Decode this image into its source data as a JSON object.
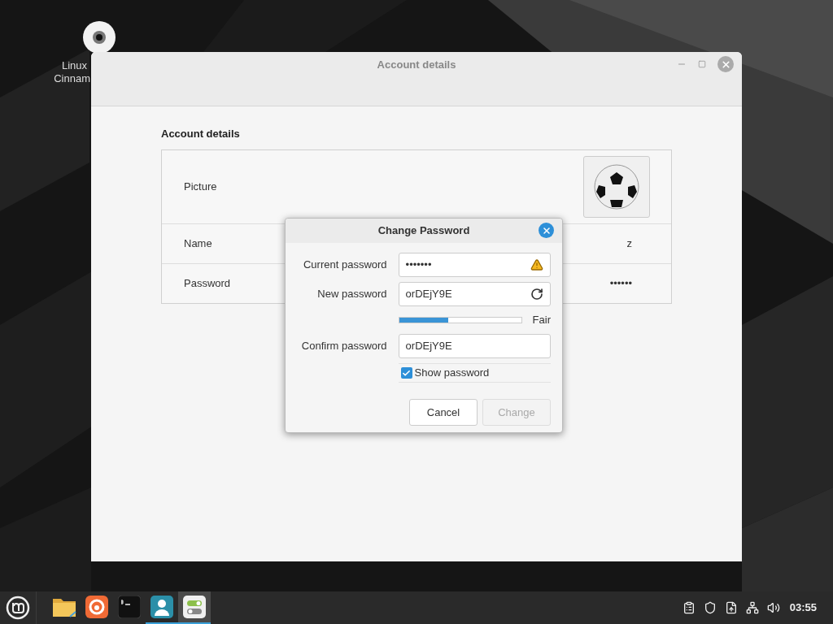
{
  "desktop": {
    "icons": [
      {
        "label_lines": [
          "Linux",
          "Cinnam"
        ]
      }
    ]
  },
  "window": {
    "title": "Account details",
    "section_title": "Account details",
    "rows": [
      {
        "kind": "picture",
        "label": "Picture"
      },
      {
        "kind": "text",
        "label": "Name",
        "value": "z"
      },
      {
        "kind": "text",
        "label": "Password",
        "value": "••••••"
      }
    ]
  },
  "dialog": {
    "title": "Change Password",
    "fields": [
      {
        "kind": "warning",
        "label": "Current password",
        "value": "•••••••"
      },
      {
        "kind": "refresh",
        "label": "New password",
        "value": "orDEjY9E"
      },
      {
        "kind": "strength",
        "level": 0.4,
        "reading": "Fair"
      },
      {
        "kind": "plain",
        "label": "Confirm password",
        "value": "orDEjY9E"
      }
    ],
    "show_password": {
      "label": "Show password",
      "checked": true
    },
    "buttons": [
      {
        "label": "Cancel",
        "disabled": false
      },
      {
        "label": "Change",
        "disabled": true
      }
    ]
  },
  "taskbar": {
    "launchers": [
      {
        "kind": "folder",
        "running": false,
        "highlighted": false
      },
      {
        "kind": "browser",
        "running": false,
        "highlighted": false
      },
      {
        "kind": "terminal",
        "running": false,
        "highlighted": false
      },
      {
        "kind": "users",
        "running": true,
        "highlighted": false
      },
      {
        "kind": "settings",
        "running": true,
        "highlighted": true
      }
    ],
    "clock": "03:55"
  }
}
